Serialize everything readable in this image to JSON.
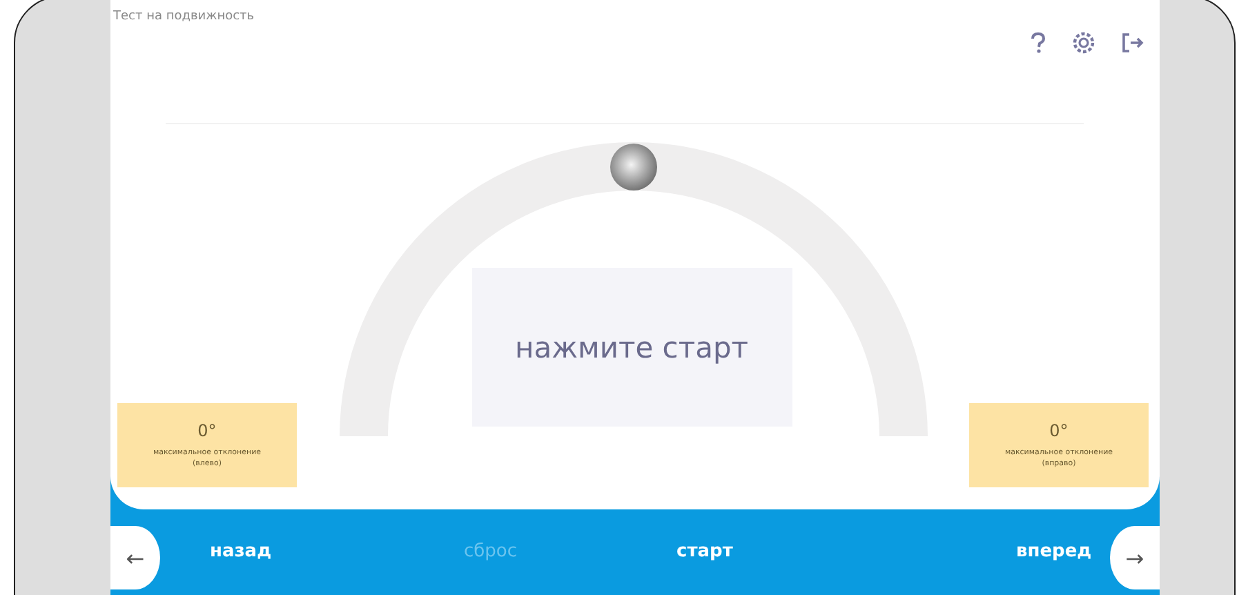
{
  "title": "Тест на подвижность",
  "prompt": "нажмите старт",
  "readings": [
    {
      "value": "0°",
      "caption": "максимальное отклонение (влево)"
    },
    {
      "value": "0°",
      "caption": "максимальное отклонение (вправо)"
    }
  ],
  "nav": {
    "back_arrow": "←",
    "forward_arrow": "→"
  },
  "buttons": [
    {
      "label": "назад",
      "disabled": false
    },
    {
      "label": "сброс",
      "disabled": true
    },
    {
      "label": "старт",
      "disabled": false
    },
    {
      "label": "вперед",
      "disabled": false
    }
  ]
}
